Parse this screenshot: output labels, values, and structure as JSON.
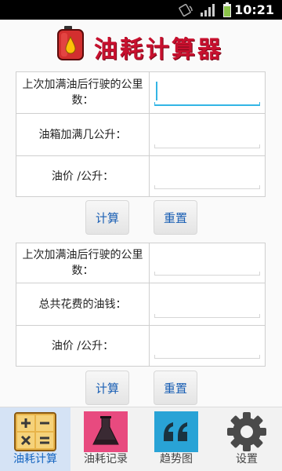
{
  "status_bar": {
    "time": "10:21"
  },
  "header": {
    "title": "油耗计算器"
  },
  "form_consumption": {
    "rows": [
      {
        "label": "上次加满油后行驶的公里数：",
        "value": ""
      },
      {
        "label": "油箱加满几公升：",
        "value": ""
      },
      {
        "label": "油价 /公升：",
        "value": ""
      }
    ],
    "calculate_label": "计算",
    "reset_label": "重置"
  },
  "form_cost": {
    "rows": [
      {
        "label": "上次加满油后行驶的公里数：",
        "value": ""
      },
      {
        "label": "总共花费的油钱：",
        "value": ""
      },
      {
        "label": "油价 /公升：",
        "value": ""
      }
    ],
    "calculate_label": "计算",
    "reset_label": "重置"
  },
  "bottom_nav": {
    "items": [
      {
        "label": "油耗计算",
        "icon": "calculator-icon"
      },
      {
        "label": "油耗记录",
        "icon": "flask-icon"
      },
      {
        "label": "趋势图",
        "icon": "quote-icon"
      },
      {
        "label": "设置",
        "icon": "gear-icon"
      }
    ],
    "active_index": 0
  },
  "colors": {
    "title": "#c8102e",
    "accent": "#33b5e5",
    "button_text": "#1a5fb4",
    "nav_active_bg": "#d5e3f5"
  }
}
